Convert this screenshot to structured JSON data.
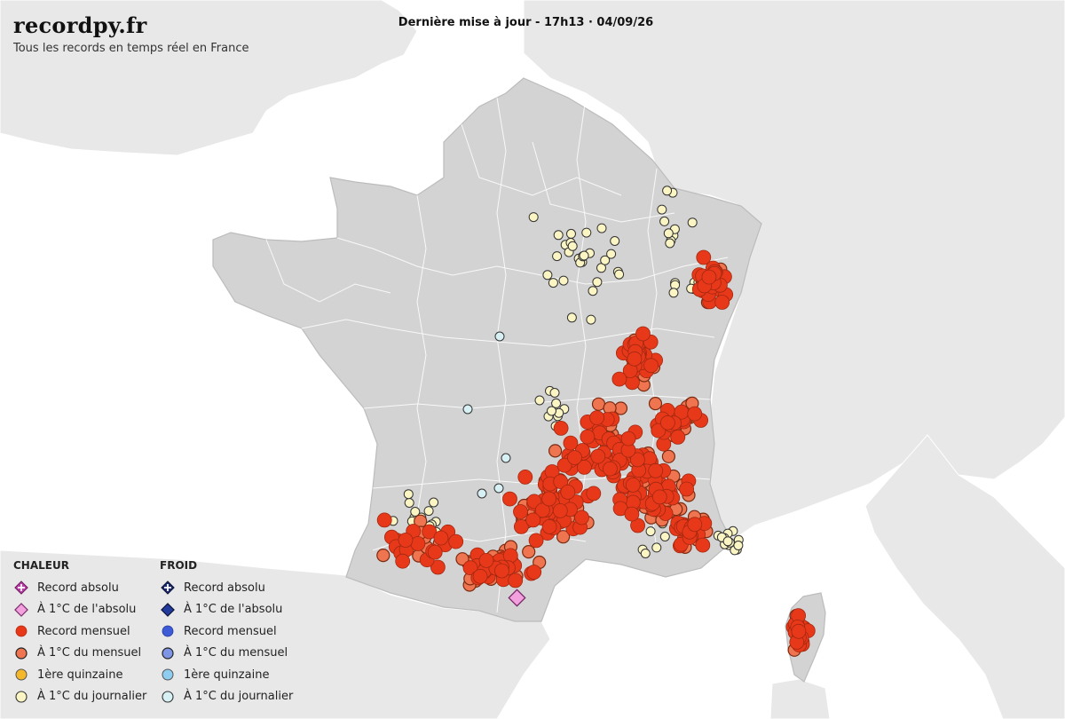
{
  "header": {
    "brand": "recordpy.fr",
    "tagline": "Tous les records en temps réel en France",
    "update": "Dernière mise à jour - 17h13 · 04/09/26"
  },
  "legend": {
    "heat": {
      "title": "CHALEUR",
      "items": [
        {
          "label": "Record absolu",
          "icon": "plus-diamond-icon",
          "color": "#c03aa8"
        },
        {
          "label": "À 1°C de l'absolu",
          "icon": "diamond-icon",
          "color": "#f3a0de"
        },
        {
          "label": "Record mensuel",
          "icon": "dot-icon",
          "color": "#e8381a"
        },
        {
          "label": "À 1°C du mensuel",
          "icon": "ringed-dot-icon",
          "color": "#ef7550"
        },
        {
          "label": "1ère quinzaine",
          "icon": "dot-icon",
          "color": "#f5b82a"
        },
        {
          "label": "À 1°C du journalier",
          "icon": "ringed-dot-icon",
          "color": "#fbf5c4"
        }
      ]
    },
    "cold": {
      "title": "FROID",
      "items": [
        {
          "label": "Record absolu",
          "icon": "plus-diamond-icon",
          "color": "#1c2a6e"
        },
        {
          "label": "À 1°C de l'absolu",
          "icon": "diamond-icon",
          "color": "#223a9c"
        },
        {
          "label": "Record mensuel",
          "icon": "dot-icon",
          "color": "#3d5bd6"
        },
        {
          "label": "À 1°C du mensuel",
          "icon": "ringed-dot-icon",
          "color": "#7f95e6"
        },
        {
          "label": "1ère quinzaine",
          "icon": "dot-icon",
          "color": "#8fcdf0"
        },
        {
          "label": "À 1°C du journalier",
          "icon": "ringed-dot-icon",
          "color": "#d6f0f4"
        }
      ]
    }
  },
  "map": {
    "colors": {
      "sea": "#ffffff",
      "france": "#d3d3d3",
      "neighbors": "#e8e8e8",
      "borders": "#ffffff"
    },
    "markers": {
      "record_mensuel": 300,
      "a_1c_du_mensuel": 150,
      "a_1c_du_journalier": 95,
      "a_1c_de_labsolu_chaleur": 1,
      "a_1c_du_journalier_froid": 5
    }
  }
}
